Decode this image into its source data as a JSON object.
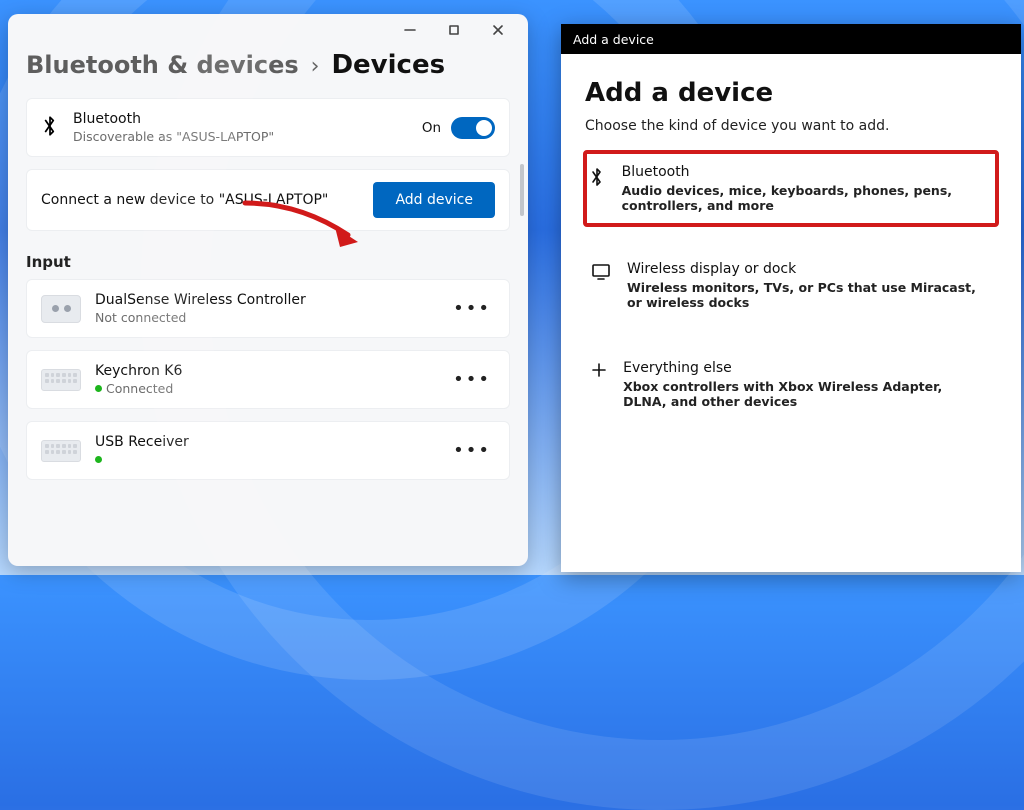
{
  "left": {
    "breadcrumb": {
      "parent": "Bluetooth & devices",
      "current": "Devices"
    },
    "bluetooth_card": {
      "title": "Bluetooth",
      "sub": "Discoverable as \"ASUS-LAPTOP\"",
      "toggle_state": "On"
    },
    "connect_card": {
      "text": "Connect a new device to \"ASUS-LAPTOP\"",
      "button": "Add device"
    },
    "section_input": "Input",
    "devices": [
      {
        "name": "DualSense Wireless Controller",
        "status_text": "Not connected",
        "connected": false
      },
      {
        "name": "Keychron K6",
        "status_text": "Connected",
        "connected": true
      },
      {
        "name": "USB Receiver",
        "status_text": "",
        "connected": true
      }
    ]
  },
  "right": {
    "titlebar": "Add a device",
    "heading": "Add a device",
    "lead": "Choose the kind of device you want to add.",
    "options": [
      {
        "title": "Bluetooth",
        "sub": "Audio devices, mice, keyboards, phones, pens, controllers, and more",
        "highlight": true
      },
      {
        "title": "Wireless display or dock",
        "sub": "Wireless monitors, TVs, or PCs that use Miracast, or wireless docks",
        "highlight": false
      },
      {
        "title": "Everything else",
        "sub": "Xbox controllers with Xbox Wireless Adapter, DLNA, and other devices",
        "highlight": false
      }
    ]
  }
}
